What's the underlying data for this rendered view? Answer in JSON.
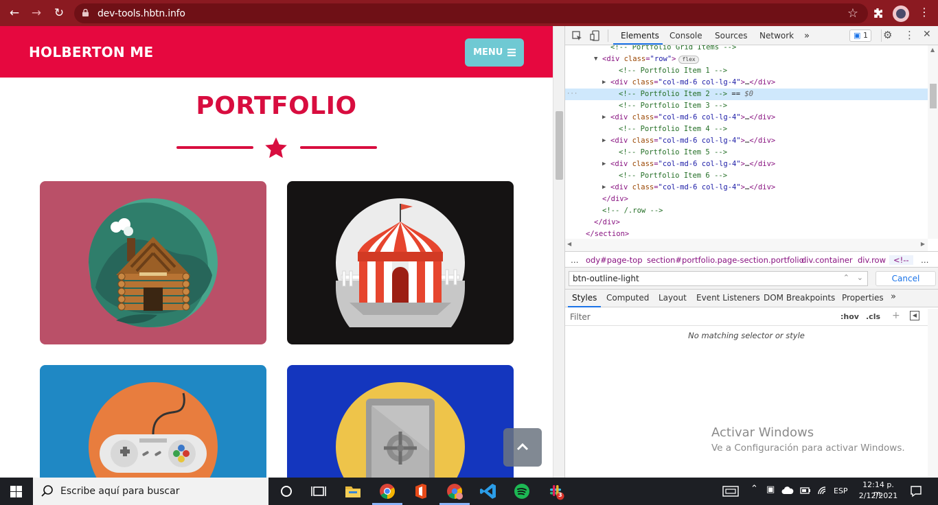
{
  "browser": {
    "url": "dev-tools.hbtn.info"
  },
  "site": {
    "brand": "HOLBERTON ME",
    "menu_label": "MENU",
    "section_title": "PORTFOLIO"
  },
  "devtools": {
    "tabs": [
      "Elements",
      "Console",
      "Sources",
      "Network"
    ],
    "issues_count": "1",
    "dom_lines": [
      {
        "indent": 5,
        "parts": [
          [
            "com",
            "<!-- Portfolio Grid Items -->"
          ]
        ]
      },
      {
        "indent": 4,
        "tri": "▼",
        "parts": [
          [
            "tag",
            "<div "
          ],
          [
            "attr",
            "class"
          ],
          [
            "tag",
            "="
          ],
          [
            "val",
            "\"row\""
          ],
          [
            "tag",
            ">"
          ]
        ],
        "badge": "flex"
      },
      {
        "indent": 6,
        "parts": [
          [
            "com",
            "<!-- Portfolio Item 1 -->"
          ]
        ]
      },
      {
        "indent": 5,
        "tri": "▶",
        "parts": [
          [
            "tag",
            "<div "
          ],
          [
            "attr",
            "class"
          ],
          [
            "tag",
            "="
          ],
          [
            "val",
            "\"col-md-6 col-lg-4\""
          ],
          [
            "tag",
            ">"
          ],
          [
            "txt",
            "…"
          ],
          [
            "tag",
            "</div>"
          ]
        ]
      },
      {
        "indent": 6,
        "sel": true,
        "parts": [
          [
            "com",
            "<!-- Portfolio Item 2 -->"
          ],
          [
            "txt",
            " == "
          ],
          [
            "dollar",
            "$0"
          ]
        ]
      },
      {
        "indent": 6,
        "parts": [
          [
            "com",
            "<!-- Portfolio Item 3 -->"
          ]
        ]
      },
      {
        "indent": 5,
        "tri": "▶",
        "parts": [
          [
            "tag",
            "<div "
          ],
          [
            "attr",
            "class"
          ],
          [
            "tag",
            "="
          ],
          [
            "val",
            "\"col-md-6 col-lg-4\""
          ],
          [
            "tag",
            ">"
          ],
          [
            "txt",
            "…"
          ],
          [
            "tag",
            "</div>"
          ]
        ]
      },
      {
        "indent": 6,
        "parts": [
          [
            "com",
            "<!-- Portfolio Item 4 -->"
          ]
        ]
      },
      {
        "indent": 5,
        "tri": "▶",
        "parts": [
          [
            "tag",
            "<div "
          ],
          [
            "attr",
            "class"
          ],
          [
            "tag",
            "="
          ],
          [
            "val",
            "\"col-md-6 col-lg-4\""
          ],
          [
            "tag",
            ">"
          ],
          [
            "txt",
            "…"
          ],
          [
            "tag",
            "</div>"
          ]
        ]
      },
      {
        "indent": 6,
        "parts": [
          [
            "com",
            "<!-- Portfolio Item 5 -->"
          ]
        ]
      },
      {
        "indent": 5,
        "tri": "▶",
        "parts": [
          [
            "tag",
            "<div "
          ],
          [
            "attr",
            "class"
          ],
          [
            "tag",
            "="
          ],
          [
            "val",
            "\"col-md-6 col-lg-4\""
          ],
          [
            "tag",
            ">"
          ],
          [
            "txt",
            "…"
          ],
          [
            "tag",
            "</div>"
          ]
        ]
      },
      {
        "indent": 6,
        "parts": [
          [
            "com",
            "<!-- Portfolio Item 6 -->"
          ]
        ]
      },
      {
        "indent": 5,
        "tri": "▶",
        "parts": [
          [
            "tag",
            "<div "
          ],
          [
            "attr",
            "class"
          ],
          [
            "tag",
            "="
          ],
          [
            "val",
            "\"col-md-6 col-lg-4\""
          ],
          [
            "tag",
            ">"
          ],
          [
            "txt",
            "…"
          ],
          [
            "tag",
            "</div>"
          ]
        ]
      },
      {
        "indent": 4,
        "parts": [
          [
            "tag",
            "</div>"
          ]
        ]
      },
      {
        "indent": 4,
        "parts": [
          [
            "com",
            "<!-- /.row -->"
          ]
        ]
      },
      {
        "indent": 3,
        "parts": [
          [
            "tag",
            "</div>"
          ]
        ]
      },
      {
        "indent": 2,
        "parts": [
          [
            "tag",
            "</section>"
          ]
        ]
      }
    ],
    "breadcrumbs": [
      "…",
      "ody#page-top",
      "section#portfolio.page-section.portfolio",
      "div.container",
      "div.row",
      "<!--"
    ],
    "search_value": "btn-outline-light",
    "cancel_label": "Cancel",
    "subtabs": [
      "Styles",
      "Computed",
      "Layout",
      "Event Listeners",
      "DOM Breakpoints",
      "Properties"
    ],
    "filter_placeholder": "Filter",
    "hov_label": ":hov",
    "cls_label": ".cls",
    "no_match": "No matching selector or style"
  },
  "windows": {
    "watermark_title": "Activar Windows",
    "watermark_sub": "Ve a Configuración para activar Windows.",
    "search_placeholder": "Escribe aquí para buscar",
    "lang": "ESP",
    "time": "12:14 p. m.",
    "date": "2/12/2021",
    "slack_badge": "3"
  },
  "colors": {
    "brand_red": "#e6083f",
    "title_red": "#d80d3f",
    "menu_teal": "#6fc9d3",
    "chrome_bar": "#8b1a21",
    "card_pink": "#ba5068",
    "card_black": "#151313",
    "card_blue": "#1f88c4",
    "card_navy": "#1436be"
  }
}
